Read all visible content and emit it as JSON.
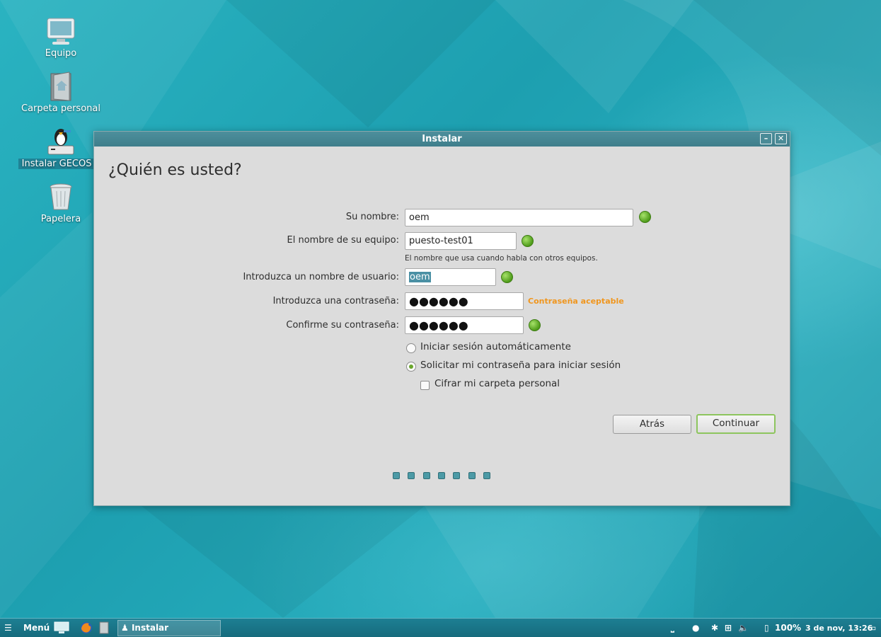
{
  "desktop": {
    "icons": [
      {
        "label": "Equipo",
        "icon": "computer-icon"
      },
      {
        "label": "Carpeta personal",
        "icon": "home-folder-icon"
      },
      {
        "label": "Instalar GECOS v",
        "icon": "installer-icon"
      },
      {
        "label": "Papelera",
        "icon": "trash-icon"
      }
    ]
  },
  "window": {
    "title": "Instalar",
    "heading": "¿Quién es usted?",
    "form": {
      "name_label": "Su nombre:",
      "name_value": "oem",
      "computer_label": "El nombre de su equipo:",
      "computer_value": "puesto-test01",
      "computer_hint": "El nombre que usa cuando habla con otros equipos.",
      "username_label": "Introduzca un nombre de usuario:",
      "username_value": "oem",
      "password_label": "Introduzca una contraseña:",
      "password_value": "●●●●●●",
      "password_strength": "Contraseña aceptable",
      "confirm_label": "Confirme su contraseña:",
      "confirm_value": "●●●●●●",
      "auto_login_label": "Iniciar sesión automáticamente",
      "ask_password_label": "Solicitar mi contraseña para iniciar sesión",
      "encrypt_label": "Cifrar mi carpeta personal"
    },
    "buttons": {
      "back": "Atrás",
      "continue": "Continuar"
    },
    "progress": {
      "total_steps": 7
    }
  },
  "taskbar": {
    "menu_label": "Menú",
    "task_label": "Instalar",
    "battery": "100%",
    "clock": "3 de nov, 13:26"
  },
  "colors": {
    "accent": "#4c9aa6",
    "ok_green": "#4f9c1a",
    "strength_orange": "#f0961e",
    "titlebar": "#4d8f9c",
    "taskbar": "#1d7f93"
  }
}
